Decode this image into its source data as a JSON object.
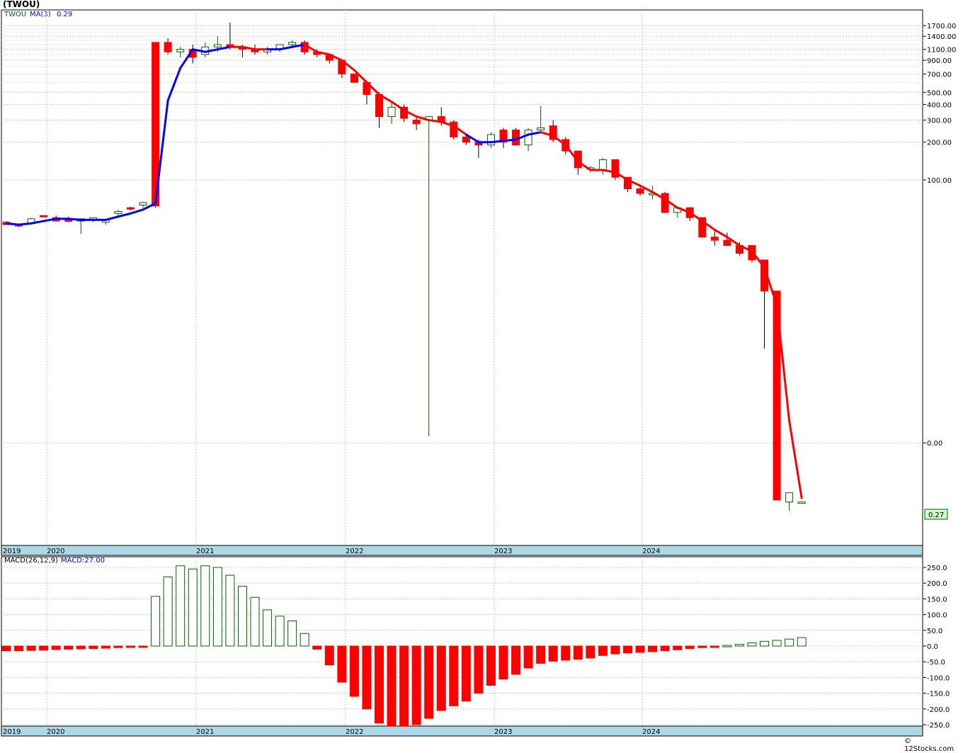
{
  "title": "(TWOU)",
  "footer": "© 12Stocks.com",
  "chart_data": [
    {
      "type": "candlestick",
      "scale": "log",
      "legend": {
        "ticker": "TWOU",
        "ma_label": "MA(3)",
        "ma_value": "0.29"
      },
      "y_ticks": [
        {
          "v": 1700,
          "label": "1700.00"
        },
        {
          "v": 1400,
          "label": "1400.00"
        },
        {
          "v": 1100,
          "label": "1100.00"
        },
        {
          "v": 900,
          "label": "900.00"
        },
        {
          "v": 700,
          "label": "700.00"
        },
        {
          "v": 500,
          "label": "500.00"
        },
        {
          "v": 400,
          "label": "400.00"
        },
        {
          "v": 300,
          "label": "300.00"
        },
        {
          "v": 200,
          "label": "200.00"
        },
        {
          "v": 100,
          "label": "100.00"
        },
        {
          "v": 0.8,
          "label": "0.00"
        }
      ],
      "minor_grid": [
        1600,
        1500,
        1300,
        1200,
        1000,
        800,
        600
      ],
      "x_labels": [
        "2019",
        "2020",
        "2021",
        "2022",
        "2023",
        "2024"
      ],
      "last_price_label": "0.27",
      "last_price": 0.27,
      "months_start": "2019-01",
      "candles": [
        [
          46,
          47,
          45,
          44
        ],
        [
          44,
          44,
          42,
          43
        ],
        [
          45,
          50,
          44,
          49
        ],
        [
          52,
          52,
          51,
          51
        ],
        [
          50,
          52,
          47,
          47
        ],
        [
          48,
          51,
          46,
          47
        ],
        [
          47,
          48,
          37,
          49
        ],
        [
          48,
          50,
          46,
          50
        ],
        [
          46,
          47,
          44,
          48
        ],
        [
          54,
          58,
          51,
          56
        ],
        [
          60,
          61,
          57,
          59
        ],
        [
          63,
          67,
          60,
          66
        ],
        [
          1250,
          1250,
          60,
          62
        ],
        [
          1250,
          1350,
          1000,
          1050
        ],
        [
          1050,
          1150,
          950,
          1100
        ],
        [
          1100,
          1200,
          850,
          950
        ],
        [
          1000,
          1250,
          950,
          1150
        ],
        [
          1150,
          1400,
          1050,
          1200
        ],
        [
          1200,
          1800,
          1100,
          1150
        ],
        [
          1150,
          1200,
          950,
          1100
        ],
        [
          1100,
          1200,
          1000,
          1050
        ],
        [
          1050,
          1150,
          1000,
          1100
        ],
        [
          1100,
          1150,
          1050,
          1200
        ],
        [
          1200,
          1300,
          1150,
          1250
        ],
        [
          1250,
          1300,
          1000,
          1050
        ],
        [
          1050,
          1100,
          950,
          1000
        ],
        [
          1000,
          1000,
          850,
          900
        ],
        [
          900,
          900,
          650,
          700
        ],
        [
          700,
          700,
          600,
          600
        ],
        [
          600,
          620,
          400,
          480
        ],
        [
          480,
          500,
          260,
          320
        ],
        [
          320,
          420,
          280,
          380
        ],
        [
          380,
          400,
          290,
          310
        ],
        [
          300,
          320,
          250,
          280
        ],
        [
          300,
          320,
          0.9,
          320
        ],
        [
          320,
          380,
          270,
          290
        ],
        [
          290,
          300,
          210,
          220
        ],
        [
          220,
          230,
          190,
          200
        ],
        [
          200,
          210,
          150,
          190
        ],
        [
          190,
          240,
          180,
          230
        ],
        [
          250,
          260,
          180,
          200
        ],
        [
          250,
          260,
          200,
          190
        ],
        [
          190,
          260,
          170,
          250
        ],
        [
          250,
          390,
          240,
          260
        ],
        [
          270,
          300,
          200,
          210
        ],
        [
          210,
          220,
          160,
          170
        ],
        [
          170,
          170,
          110,
          125
        ],
        [
          125,
          130,
          115,
          125
        ],
        [
          120,
          150,
          110,
          145
        ],
        [
          145,
          145,
          100,
          105
        ],
        [
          105,
          105,
          80,
          85
        ],
        [
          85,
          90,
          75,
          78
        ],
        [
          78,
          90,
          70,
          78
        ],
        [
          78,
          80,
          55,
          55
        ],
        [
          55,
          60,
          50,
          60
        ],
        [
          60,
          60,
          47,
          50
        ],
        [
          50,
          50,
          40,
          35
        ],
        [
          35,
          40,
          30,
          33
        ],
        [
          33,
          38,
          30,
          30
        ],
        [
          30,
          32,
          25,
          26
        ],
        [
          30,
          30,
          22,
          23
        ],
        [
          23,
          23,
          4.5,
          13
        ],
        [
          13,
          13,
          4,
          0.28
        ],
        [
          0.27,
          0.29,
          0.23,
          0.32
        ],
        [
          0.27,
          0.27,
          0.27,
          0.27
        ]
      ],
      "ma3": [
        45,
        44,
        45,
        47,
        49,
        49,
        48,
        48,
        48,
        51,
        54,
        58,
        65,
        430,
        780,
        1100,
        1050,
        1100,
        1150,
        1150,
        1100,
        1100,
        1100,
        1150,
        1200,
        1050,
        1000,
        900,
        750,
        600,
        480,
        420,
        360,
        320,
        300,
        290,
        270,
        230,
        200,
        200,
        205,
        210,
        230,
        240,
        225,
        190,
        140,
        120,
        120,
        115,
        100,
        90,
        80,
        70,
        60,
        55,
        47,
        40,
        35,
        30,
        27,
        20,
        10,
        1.2,
        0.29
      ],
      "ma3_colors": [
        "blue",
        "blue",
        "blue",
        "blue",
        "blue",
        "blue",
        "blue",
        "blue",
        "blue",
        "blue",
        "blue",
        "blue",
        "blue",
        "blue",
        "blue",
        "blue",
        "blue",
        "blue",
        "blue",
        "red",
        "red",
        "red",
        "blue",
        "blue",
        "blue",
        "red",
        "red",
        "red",
        "red",
        "red",
        "red",
        "red",
        "red",
        "red",
        "red",
        "red",
        "red",
        "red",
        "blue",
        "blue",
        "blue",
        "blue",
        "blue",
        "blue",
        "red",
        "red",
        "red",
        "red",
        "red",
        "red",
        "red",
        "red",
        "red",
        "red",
        "red",
        "red",
        "red",
        "red",
        "red",
        "red",
        "red",
        "red",
        "red",
        "red",
        "red"
      ]
    },
    {
      "type": "bar",
      "legend": {
        "macd_label": "MACD(26,12,9)",
        "macd_value": "MACD:27.00"
      },
      "y_ticks": [
        250,
        200,
        150,
        100,
        50,
        0,
        -50,
        -100,
        -150,
        -200,
        -250
      ],
      "y_tick_labels": [
        "250.0",
        "200.0",
        "150.0",
        "100.0",
        "50.0",
        "0.0",
        "-50.0",
        "-100.0",
        "-150.0",
        "-200.0",
        "-250.0"
      ],
      "ylim": [
        -250,
        250
      ],
      "values": [
        -15,
        -15,
        -14,
        -13,
        -11,
        -10,
        -9,
        -8,
        -7,
        -5,
        -3,
        -1,
        158,
        220,
        255,
        245,
        255,
        250,
        225,
        190,
        155,
        115,
        95,
        80,
        40,
        -10,
        -60,
        -115,
        -160,
        -200,
        -245,
        -255,
        -255,
        -250,
        -230,
        -205,
        -190,
        -175,
        -150,
        -125,
        -105,
        -90,
        -70,
        -55,
        -48,
        -45,
        -42,
        -38,
        -30,
        -25,
        -22,
        -20,
        -18,
        -15,
        -12,
        -8,
        -5,
        -2,
        2,
        5,
        10,
        15,
        18,
        22,
        27
      ]
    }
  ]
}
